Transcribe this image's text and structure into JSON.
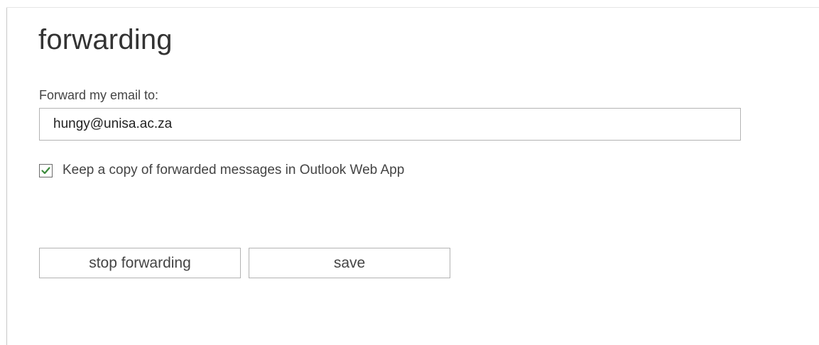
{
  "page": {
    "title": "forwarding"
  },
  "forward": {
    "label": "Forward my email to:",
    "email_value": "hungy@unisa.ac.za",
    "keep_copy_label": "Keep a copy of forwarded messages in Outlook Web App",
    "keep_copy_checked": true,
    "check_icon": "checkmark-icon",
    "check_color": "#3a8a3a"
  },
  "actions": {
    "stop_label": "stop forwarding",
    "save_label": "save"
  }
}
